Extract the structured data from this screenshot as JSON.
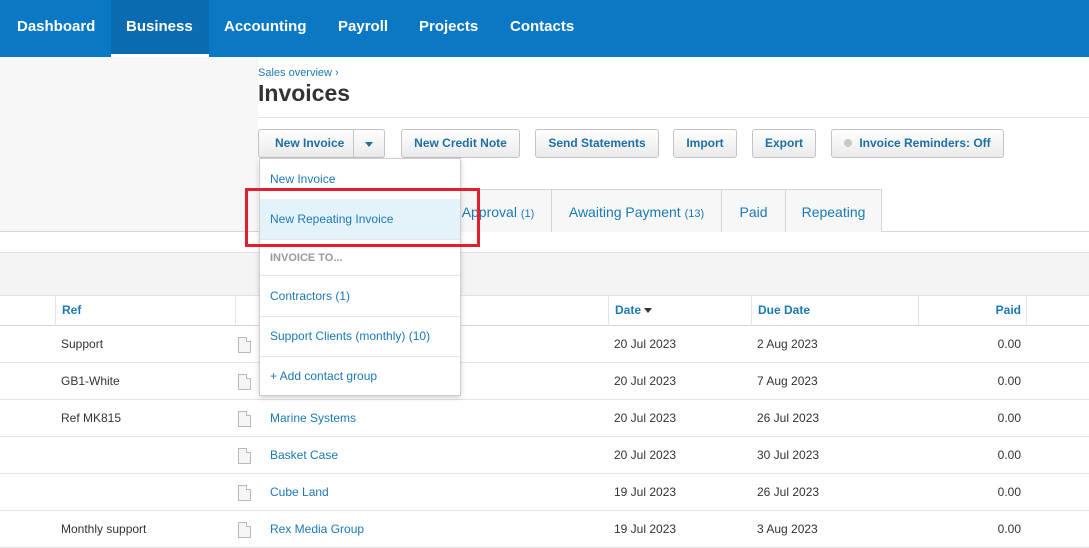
{
  "nav": {
    "items": [
      "Dashboard",
      "Business",
      "Accounting",
      "Payroll",
      "Projects",
      "Contacts"
    ],
    "active": "Business"
  },
  "breadcrumb": "Sales overview ›",
  "page_title": "Invoices",
  "toolbar": {
    "new_invoice": "New Invoice",
    "new_credit_note": "New Credit Note",
    "send_statements": "Send Statements",
    "import": "Import",
    "export": "Export",
    "invoice_reminders": "Invoice Reminders: Off"
  },
  "tabs": [
    {
      "label": "Approval",
      "count": "(1)"
    },
    {
      "label": "Awaiting Payment",
      "count": "(13)"
    },
    {
      "label": "Paid",
      "count": ""
    },
    {
      "label": "Repeating",
      "count": ""
    }
  ],
  "dropdown": {
    "new_invoice": "New Invoice",
    "new_repeating_invoice": "New Repeating Invoice",
    "invoice_to_header": "INVOICE TO...",
    "contractors": "Contractors (1)",
    "support_clients": "Support Clients (monthly) (10)",
    "add_contact_group": "+ Add contact group"
  },
  "table": {
    "columns": {
      "ref": "Ref",
      "date": "Date",
      "due_date": "Due Date",
      "paid": "Paid"
    },
    "rows": [
      {
        "ref": "Support",
        "to": "",
        "date": "20 Jul 2023",
        "due": "2 Aug 2023",
        "paid": "0.00"
      },
      {
        "ref": "GB1-White",
        "to": "",
        "date": "20 Jul 2023",
        "due": "7 Aug 2023",
        "paid": "0.00"
      },
      {
        "ref": "Ref MK815",
        "to": "Marine Systems",
        "date": "20 Jul 2023",
        "due": "26 Jul 2023",
        "paid": "0.00"
      },
      {
        "ref": "",
        "to": "Basket Case",
        "date": "20 Jul 2023",
        "due": "30 Jul 2023",
        "paid": "0.00"
      },
      {
        "ref": "",
        "to": "Cube Land",
        "date": "19 Jul 2023",
        "due": "26 Jul 2023",
        "paid": "0.00"
      },
      {
        "ref": "Monthly support",
        "to": "Rex Media Group",
        "date": "19 Jul 2023",
        "due": "3 Aug 2023",
        "paid": "0.00"
      }
    ]
  },
  "colors": {
    "nav_bg": "#0b78c5",
    "link": "#1a79b5",
    "highlight": "#e0202a",
    "dropdown_hover": "#e4f2fa"
  }
}
